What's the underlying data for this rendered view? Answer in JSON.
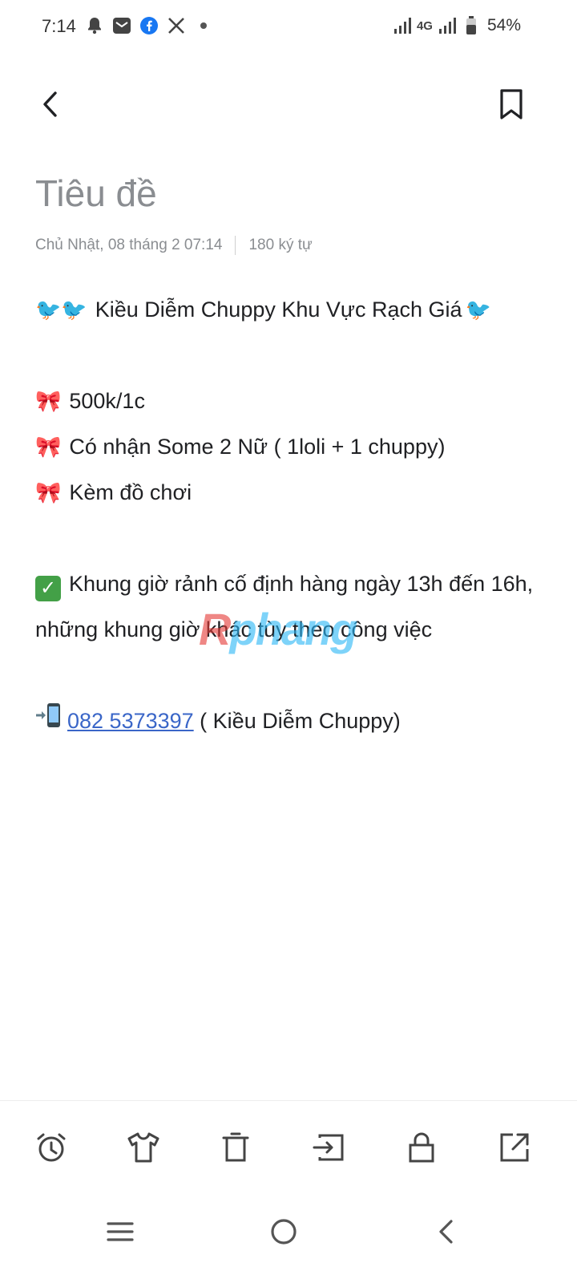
{
  "status_bar": {
    "time": "7:14",
    "network": "4G",
    "battery": "54%",
    "icons": [
      "bell-icon",
      "mail-icon",
      "facebook-icon",
      "x-icon",
      "dot-icon",
      "signal-icon",
      "signal-icon",
      "battery-icon"
    ]
  },
  "header": {
    "back_icon": "chevron-left-icon",
    "bookmark_icon": "bookmark-icon"
  },
  "note": {
    "title_placeholder": "Tiêu đề",
    "date": "Chủ Nhật, 08 tháng 2 07:14",
    "char_count": "180 ký tự",
    "line1_text": "Kiều Diễm Chuppy  Khu Vực Rạch Giá",
    "item1": "500k/1c",
    "item2": "Có nhận Some 2 Nữ ( 1loli + 1 chuppy)",
    "item3": "Kèm đồ chơi",
    "schedule": "Khung giờ rảnh cố định hàng ngày 13h đến 16h, những khung giờ khác tùy theo công việc",
    "phone": "082 5373397",
    "phone_suffix": " ( Kiều Diễm Chuppy)"
  },
  "watermark": {
    "part1": "R",
    "part2": "phang"
  },
  "toolbar": {
    "icons": [
      "alarm-icon",
      "theme-shirt-icon",
      "trash-icon",
      "move-icon",
      "lock-icon",
      "share-icon"
    ]
  },
  "navigation": {
    "icons": [
      "recent-apps-icon",
      "home-icon",
      "back-icon"
    ]
  },
  "colors": {
    "link": "#3a66c8",
    "muted_text": "#8a8d91",
    "check_green": "#43a047"
  }
}
